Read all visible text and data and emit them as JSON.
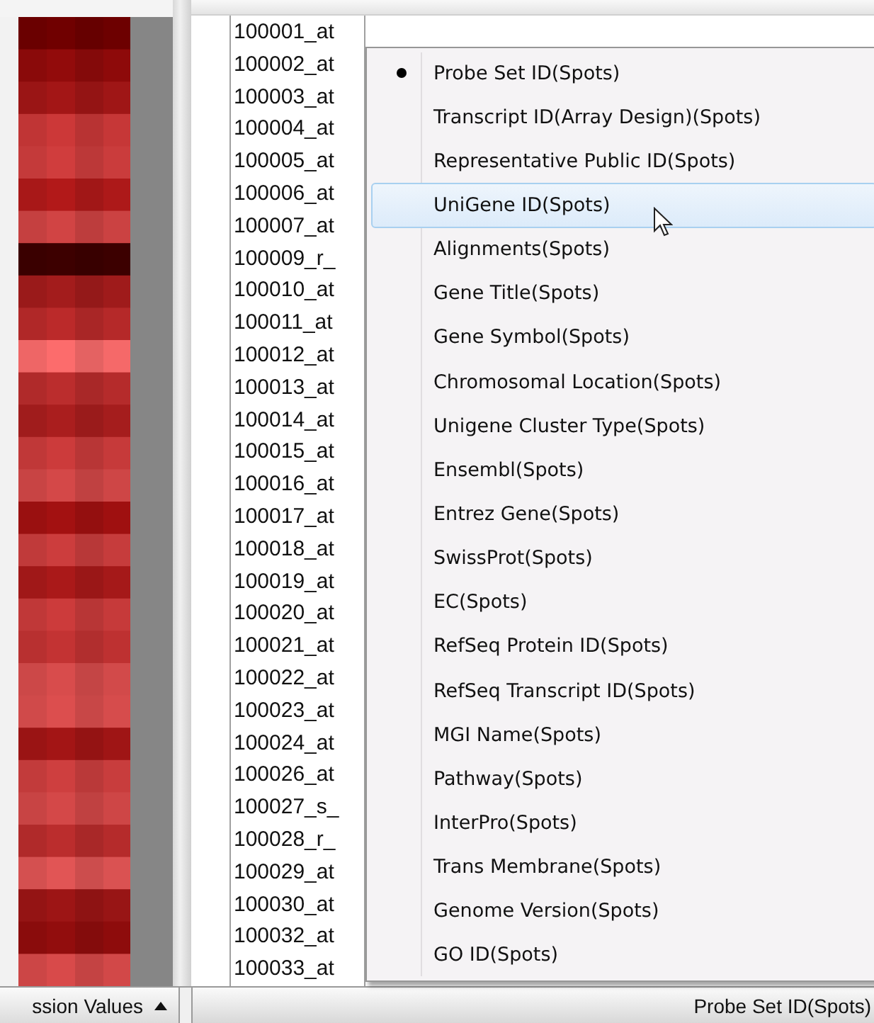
{
  "probe_list": [
    "100001_at",
    "100002_at",
    "100003_at",
    "100004_at",
    "100005_at",
    "100006_at",
    "100007_at",
    "100009_r_",
    "100010_at",
    "100011_at",
    "100012_at",
    "100013_at",
    "100014_at",
    "100015_at",
    "100016_at",
    "100017_at",
    "100018_at",
    "100019_at",
    "100020_at",
    "100021_at",
    "100022_at",
    "100023_at",
    "100024_at",
    "100026_at",
    "100027_s_",
    "100028_r_",
    "100029_at",
    "100030_at",
    "100032_at",
    "100033_at"
  ],
  "context_menu": [
    {
      "label": "Probe Set ID(Spots)",
      "selected": true,
      "highlighted": false
    },
    {
      "label": "Transcript ID(Array Design)(Spots)",
      "selected": false,
      "highlighted": false
    },
    {
      "label": "Representative Public ID(Spots)",
      "selected": false,
      "highlighted": false
    },
    {
      "label": "UniGene ID(Spots)",
      "selected": false,
      "highlighted": true
    },
    {
      "label": "Alignments(Spots)",
      "selected": false,
      "highlighted": false
    },
    {
      "label": "Gene Title(Spots)",
      "selected": false,
      "highlighted": false
    },
    {
      "label": "Gene Symbol(Spots)",
      "selected": false,
      "highlighted": false
    },
    {
      "label": "Chromosomal Location(Spots)",
      "selected": false,
      "highlighted": false
    },
    {
      "label": "Unigene Cluster Type(Spots)",
      "selected": false,
      "highlighted": false
    },
    {
      "label": "Ensembl(Spots)",
      "selected": false,
      "highlighted": false
    },
    {
      "label": "Entrez Gene(Spots)",
      "selected": false,
      "highlighted": false
    },
    {
      "label": "SwissProt(Spots)",
      "selected": false,
      "highlighted": false
    },
    {
      "label": "EC(Spots)",
      "selected": false,
      "highlighted": false
    },
    {
      "label": "RefSeq Protein ID(Spots)",
      "selected": false,
      "highlighted": false
    },
    {
      "label": "RefSeq Transcript ID(Spots)",
      "selected": false,
      "highlighted": false
    },
    {
      "label": "MGI Name(Spots)",
      "selected": false,
      "highlighted": false
    },
    {
      "label": "Pathway(Spots)",
      "selected": false,
      "highlighted": false
    },
    {
      "label": "InterPro(Spots)",
      "selected": false,
      "highlighted": false
    },
    {
      "label": "Trans Membrane(Spots)",
      "selected": false,
      "highlighted": false
    },
    {
      "label": "Genome Version(Spots)",
      "selected": false,
      "highlighted": false
    },
    {
      "label": "GO ID(Spots)",
      "selected": false,
      "highlighted": false
    }
  ],
  "heatmap_footer": {
    "label": "ssion Values"
  },
  "list_footer": {
    "label": "Probe Set ID(Spots)"
  }
}
